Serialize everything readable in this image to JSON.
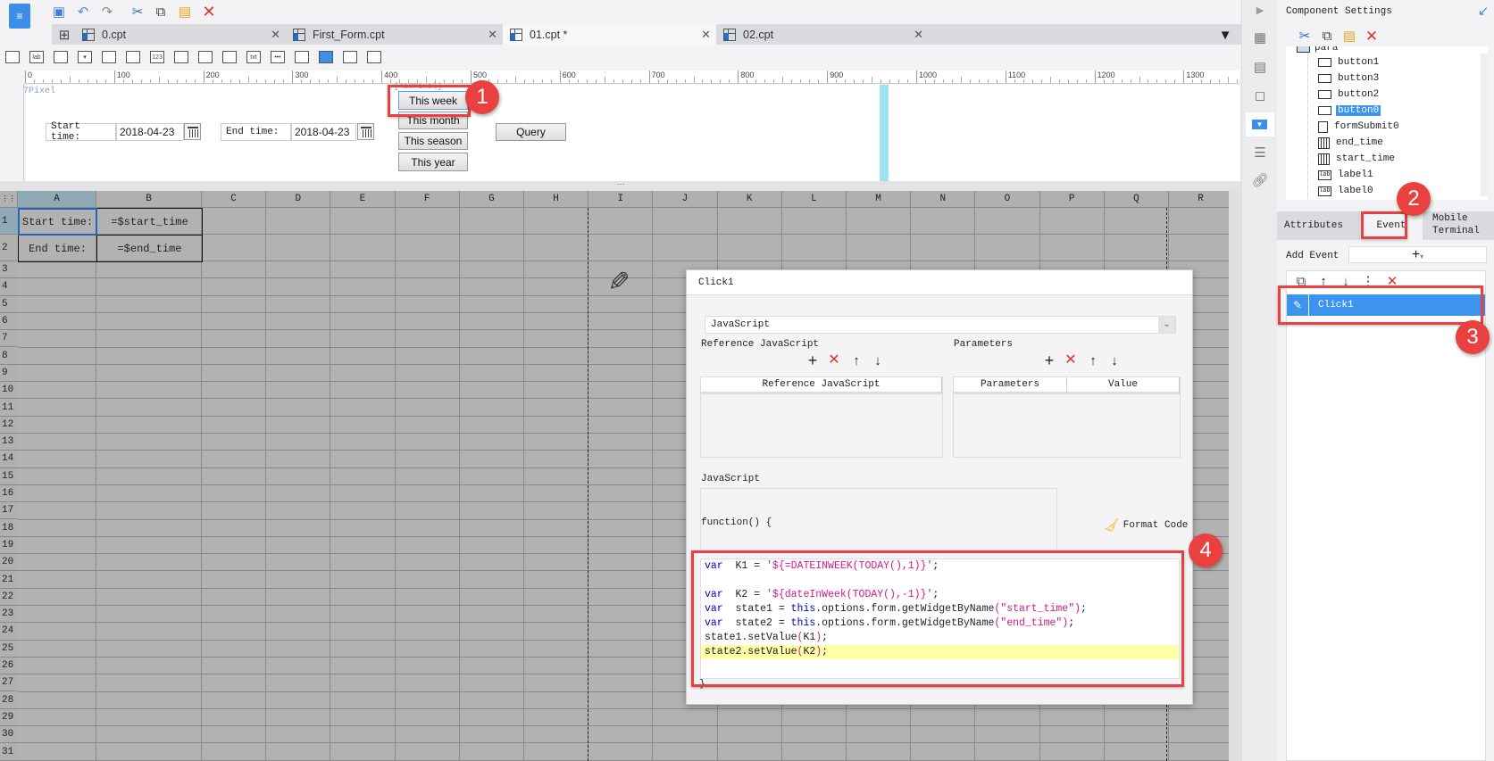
{
  "toolbar": {
    "icons": [
      "designer-logo-icon",
      "save-icon",
      "undo-icon",
      "redo-icon",
      "cut-icon",
      "copy-icon",
      "paste-icon",
      "delete-icon"
    ]
  },
  "tabs": [
    {
      "label": "0.cpt",
      "active": false
    },
    {
      "label": "First_Form.cpt",
      "active": false
    },
    {
      "label": "01.cpt *",
      "active": true
    },
    {
      "label": "02.cpt",
      "active": false
    }
  ],
  "widget_toolbar": {
    "items": [
      "",
      "lab",
      "",
      "▾",
      "",
      "",
      "123",
      "",
      "",
      "",
      "txt",
      "•••",
      "",
      "",
      "",
      ""
    ]
  },
  "ruler": {
    "ticks": [
      "0",
      "100",
      "200",
      "300",
      "400",
      "500",
      "600",
      "700",
      "800",
      "900",
      "1000",
      "1100",
      "1200",
      "1300"
    ]
  },
  "form": {
    "pixel_label": "7Pixel",
    "selection_label": "[418Pixel]",
    "start_label": "Start time:",
    "start_value": "2018-04-23",
    "end_label": "End time:",
    "end_value": "2018-04-23",
    "buttons": [
      "This week",
      "This month",
      "This season",
      "This year"
    ],
    "query": "Query"
  },
  "annotations": [
    "1",
    "2",
    "3",
    "4"
  ],
  "sheet": {
    "columns": [
      "A",
      "B",
      "C",
      "D",
      "E",
      "F",
      "G",
      "H",
      "I",
      "J",
      "K",
      "L",
      "M",
      "N",
      "O",
      "P",
      "Q",
      "R"
    ],
    "rows": [
      "1",
      "2",
      "3",
      "4",
      "5",
      "6",
      "7",
      "8",
      "9",
      "10",
      "11",
      "12",
      "13",
      "14",
      "15",
      "16",
      "17",
      "18",
      "19",
      "20",
      "21",
      "22",
      "23",
      "24",
      "25",
      "26",
      "27",
      "28",
      "29",
      "30",
      "31"
    ],
    "cells": {
      "A1": "Start time:",
      "B1": "=$start_time",
      "A2": "End time:",
      "B2": "=$end_time"
    }
  },
  "panel": {
    "title": "Component Settings",
    "tree_root": "para",
    "tree": [
      {
        "label": "button1",
        "icon": "button"
      },
      {
        "label": "button3",
        "icon": "button"
      },
      {
        "label": "button2",
        "icon": "button"
      },
      {
        "label": "button0",
        "icon": "button",
        "selected": true
      },
      {
        "label": "formSubmit0",
        "icon": "submit"
      },
      {
        "label": "end_time",
        "icon": "date"
      },
      {
        "label": "start_time",
        "icon": "date"
      },
      {
        "label": "label1",
        "icon": "label"
      },
      {
        "label": "label0",
        "icon": "label"
      }
    ],
    "tabs": {
      "attributes": "Attributes",
      "event": "Event",
      "mobile1": "Mobile",
      "mobile2": "Terminal"
    },
    "add_event": "Add Event",
    "events": [
      "Click1"
    ]
  },
  "dialog": {
    "title": "Click1",
    "type": "JavaScript",
    "ref_section": "Reference JavaScript",
    "param_section": "Parameters",
    "ref_col": "Reference JavaScript",
    "param_col": "Parameters",
    "value_col": "Value",
    "js_section": "JavaScript",
    "function_head": "function() {",
    "format_code": "Format Code",
    "closing": "}",
    "code": [
      [
        [
          "kw",
          "var"
        ],
        [
          "",
          "  K1 = "
        ],
        [
          "st",
          "'${=DATEINWEEK(TODAY(),1)}'"
        ],
        [
          "",
          ";"
        ]
      ],
      [],
      [
        [
          "kw",
          "var"
        ],
        [
          "",
          "  K2 = "
        ],
        [
          "st",
          "'${dateInWeek(TODAY(),-1)}'"
        ],
        [
          "",
          ";"
        ]
      ],
      [
        [
          "kw",
          "var"
        ],
        [
          "",
          "  state1 = "
        ],
        [
          "kw",
          "this"
        ],
        [
          "",
          ".options.form.getWidgetByName"
        ],
        [
          "pn",
          "("
        ],
        [
          "st",
          "\"start_time\""
        ],
        [
          "pn",
          ")"
        ],
        [
          "",
          ";"
        ]
      ],
      [
        [
          "kw",
          "var"
        ],
        [
          "",
          "  state2 = "
        ],
        [
          "kw",
          "this"
        ],
        [
          "",
          ".options.form.getWidgetByName"
        ],
        [
          "pn",
          "("
        ],
        [
          "st",
          "\"end_time\""
        ],
        [
          "pn",
          ")"
        ],
        [
          "",
          ";"
        ]
      ],
      [
        [
          "",
          "state1.setValue"
        ],
        [
          "pn",
          "("
        ],
        [
          "",
          "K1"
        ],
        [
          "pn",
          ")"
        ],
        [
          "",
          ";"
        ]
      ],
      [
        [
          "",
          "state2.setValue"
        ],
        [
          "pn",
          "("
        ],
        [
          "",
          "K2"
        ],
        [
          "pn",
          ")"
        ],
        [
          "",
          ";"
        ]
      ]
    ],
    "highlight_line": 6
  },
  "colors": {
    "accent": "#3d8ee8",
    "annotation": "#e8413f",
    "selection": "#3a96f0"
  }
}
